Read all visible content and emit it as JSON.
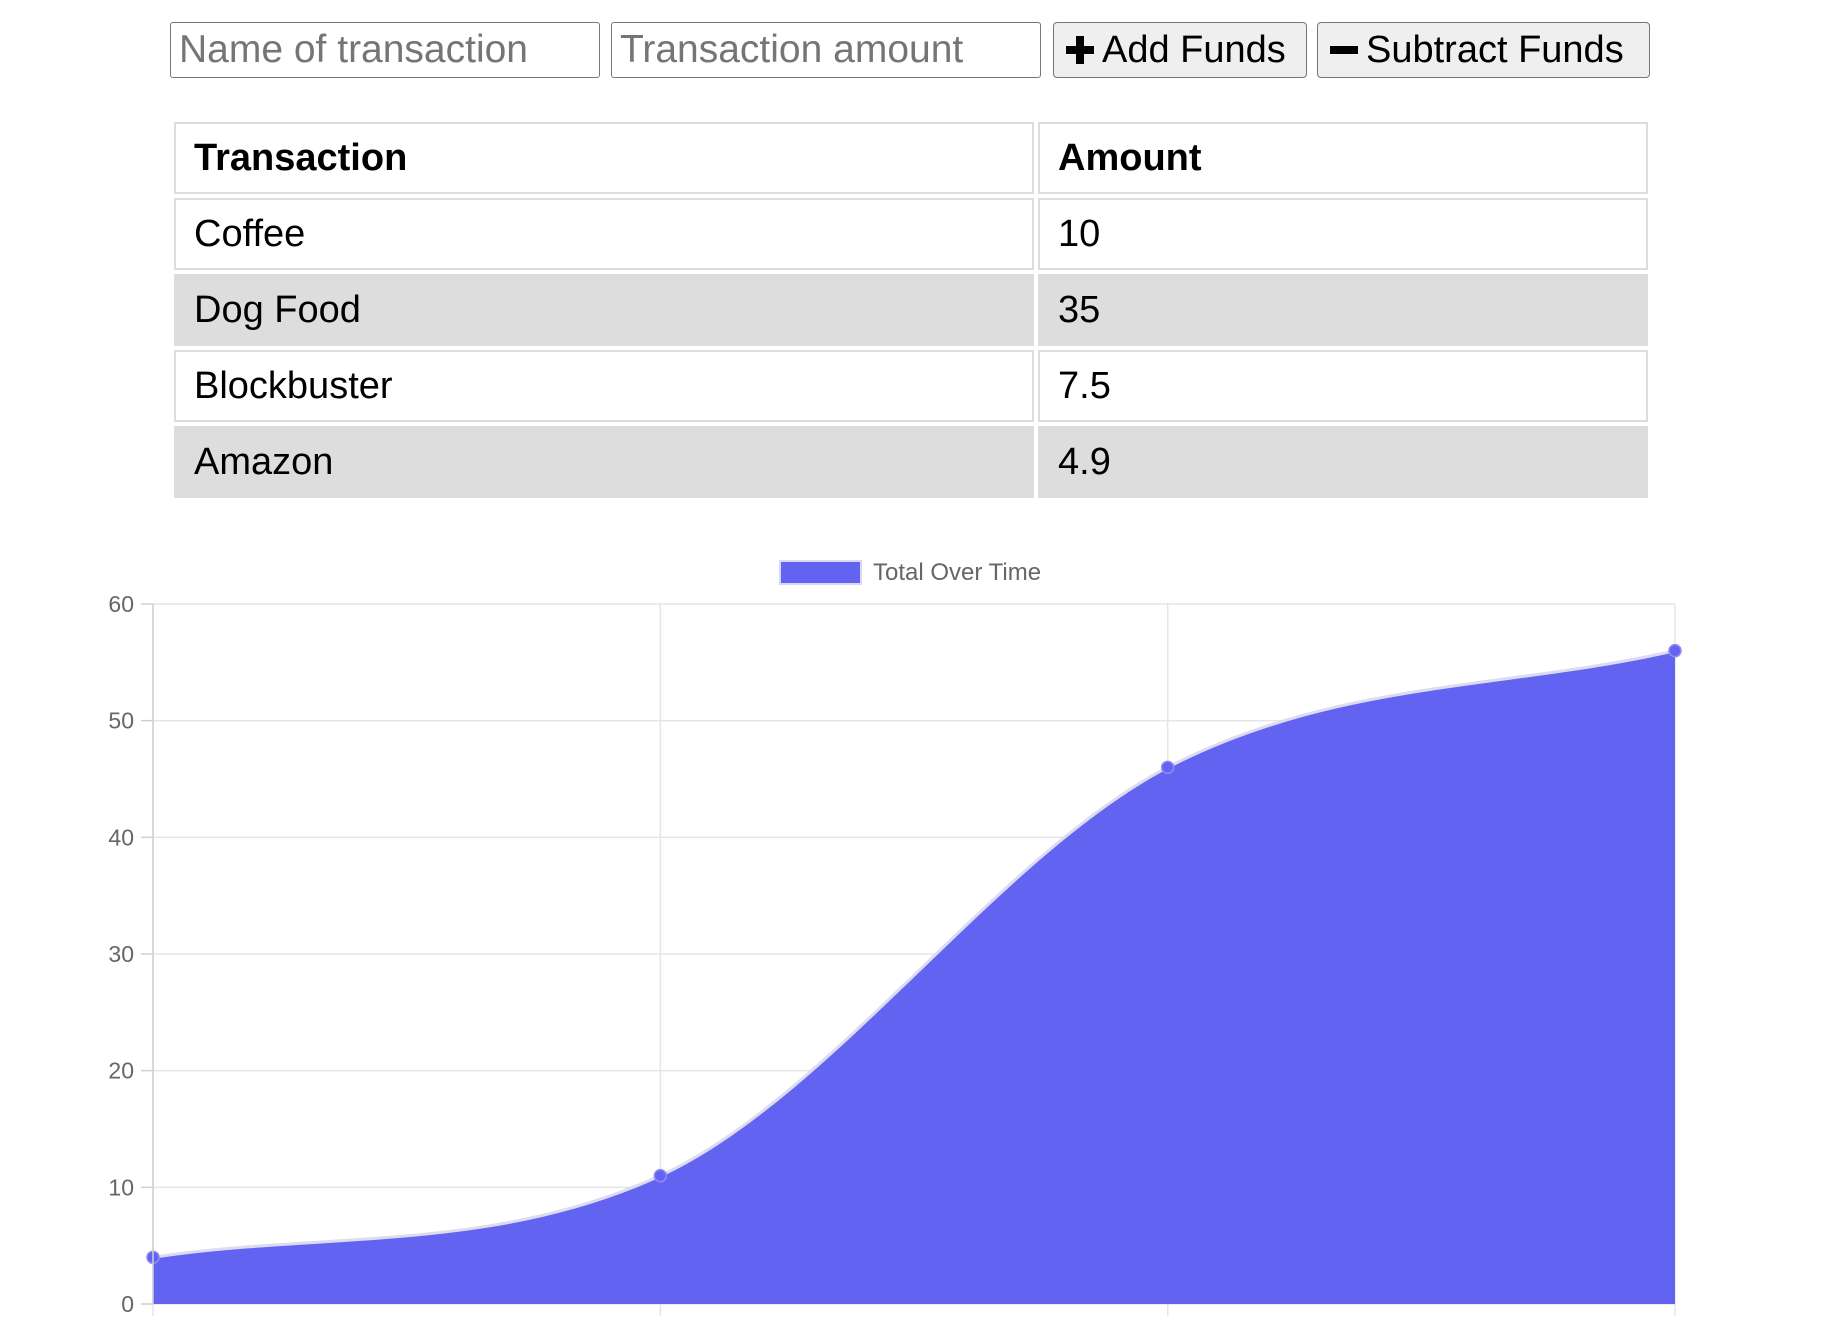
{
  "form": {
    "name_placeholder": "Name of transaction",
    "amount_placeholder": "Transaction amount",
    "add_label": "Add Funds",
    "subtract_label": "Subtract Funds"
  },
  "table": {
    "headers": [
      "Transaction",
      "Amount"
    ],
    "rows": [
      {
        "name": "Coffee",
        "amount": "10"
      },
      {
        "name": "Dog Food",
        "amount": "35"
      },
      {
        "name": "Blockbuster",
        "amount": "7.5"
      },
      {
        "name": "Amazon",
        "amount": "4.9"
      }
    ]
  },
  "chart_data": {
    "type": "area",
    "series": [
      {
        "name": "Total Over Time",
        "values": [
          4,
          11,
          46,
          56
        ],
        "color": "#6363f2"
      }
    ],
    "categories": [
      "",
      "",
      "",
      ""
    ],
    "ylim": [
      0,
      60
    ],
    "yticks": [
      0,
      10,
      20,
      30,
      40,
      50,
      60
    ],
    "grid": true,
    "legend": "top-center",
    "xlabel": "",
    "ylabel": ""
  }
}
